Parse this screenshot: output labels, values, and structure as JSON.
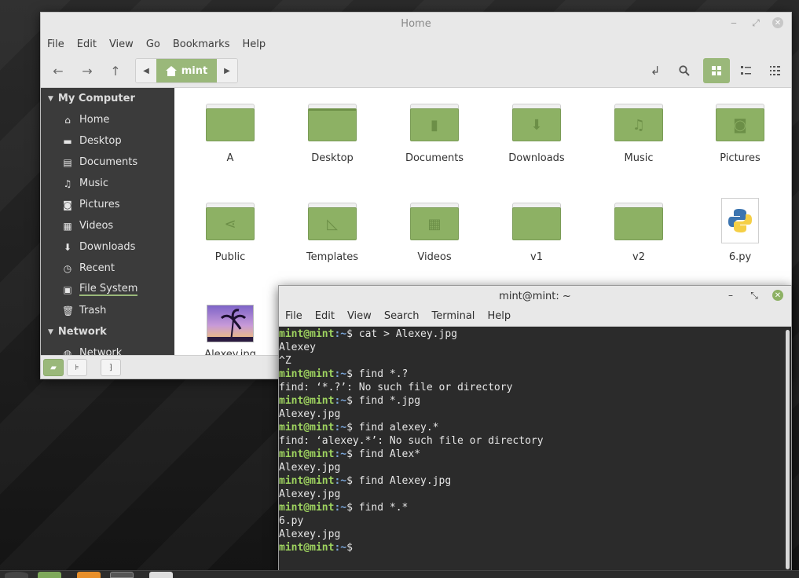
{
  "file_manager": {
    "title": "Home",
    "menu": [
      "File",
      "Edit",
      "View",
      "Go",
      "Bookmarks",
      "Help"
    ],
    "path_crumb": "mint",
    "sidebar": {
      "my_computer": "My Computer",
      "items": [
        "Home",
        "Desktop",
        "Documents",
        "Music",
        "Pictures",
        "Videos",
        "Downloads",
        "Recent",
        "File System",
        "Trash"
      ],
      "network_header": "Network",
      "network_items": [
        "Network"
      ]
    },
    "files": [
      "A",
      "Desktop",
      "Documents",
      "Downloads",
      "Music",
      "Pictures",
      "Public",
      "Templates",
      "Videos",
      "v1",
      "v2",
      "6.py",
      "Alexey.jpg"
    ]
  },
  "terminal": {
    "title": "mint@mint: ~",
    "menu": [
      "File",
      "Edit",
      "View",
      "Search",
      "Terminal",
      "Help"
    ],
    "prompt_user": "mint@mint",
    "prompt_path": ":~",
    "prompt_end": "$ ",
    "lines": [
      {
        "type": "cmd",
        "text": "cat > Alexey.jpg"
      },
      {
        "type": "out",
        "text": "Alexey"
      },
      {
        "type": "out",
        "text": "^Z"
      },
      {
        "type": "cmd",
        "text": "find *.?"
      },
      {
        "type": "out",
        "text": "find: ‘*.?’: No such file or directory"
      },
      {
        "type": "cmd",
        "text": "find *.jpg"
      },
      {
        "type": "out",
        "text": "Alexey.jpg"
      },
      {
        "type": "cmd",
        "text": "find alexey.*"
      },
      {
        "type": "out",
        "text": "find: ‘alexey.*’: No such file or directory"
      },
      {
        "type": "cmd",
        "text": "find Alex*"
      },
      {
        "type": "out",
        "text": "Alexey.jpg"
      },
      {
        "type": "cmd",
        "text": "find Alexey.jpg"
      },
      {
        "type": "out",
        "text": "Alexey.jpg"
      },
      {
        "type": "cmd",
        "text": "find *.*"
      },
      {
        "type": "out",
        "text": "6.py"
      },
      {
        "type": "out",
        "text": "Alexey.jpg"
      },
      {
        "type": "cmd",
        "text": ""
      }
    ]
  },
  "colors": {
    "accent_green": "#8db164",
    "prompt_green": "#9ed35f",
    "prompt_blue": "#7aa6da",
    "terminal_bg": "#2b2b2b",
    "sidebar_bg": "#3b3b3b"
  }
}
